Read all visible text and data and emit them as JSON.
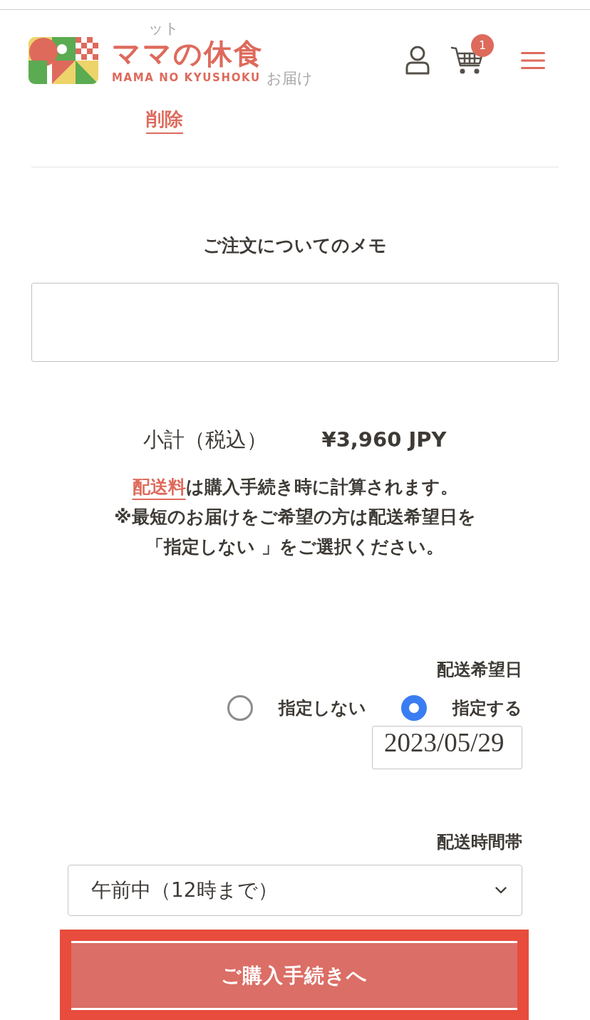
{
  "header": {
    "background_texts": [
      "ット",
      "お届け"
    ],
    "logo": {
      "title": "ママの休食",
      "subtitle": "MAMA NO KYUSHOKU"
    },
    "cart_count": "1"
  },
  "remove_link": "削除",
  "order_note": {
    "label": "ご注文についてのメモ"
  },
  "subtotal": {
    "label": "小計（税込）",
    "value": "¥3,960 JPY"
  },
  "shipping_note": {
    "link": "配送料",
    "lines": [
      "は購入手続き時に計算されます。",
      "※最短のお届けをご希望の方は配送希望日を",
      "「指定しない 」をご選択ください。"
    ]
  },
  "delivery_date": {
    "label": "配送希望日",
    "options": [
      {
        "label": "指定しない",
        "selected": false
      },
      {
        "label": "指定する",
        "selected": true
      }
    ],
    "value": "2023/05/29"
  },
  "delivery_time": {
    "label": "配送時間帯",
    "value": "午前中（12時まで）"
  },
  "checkout_button": {
    "label": "ご購入手続きへ",
    "focused": true
  }
}
